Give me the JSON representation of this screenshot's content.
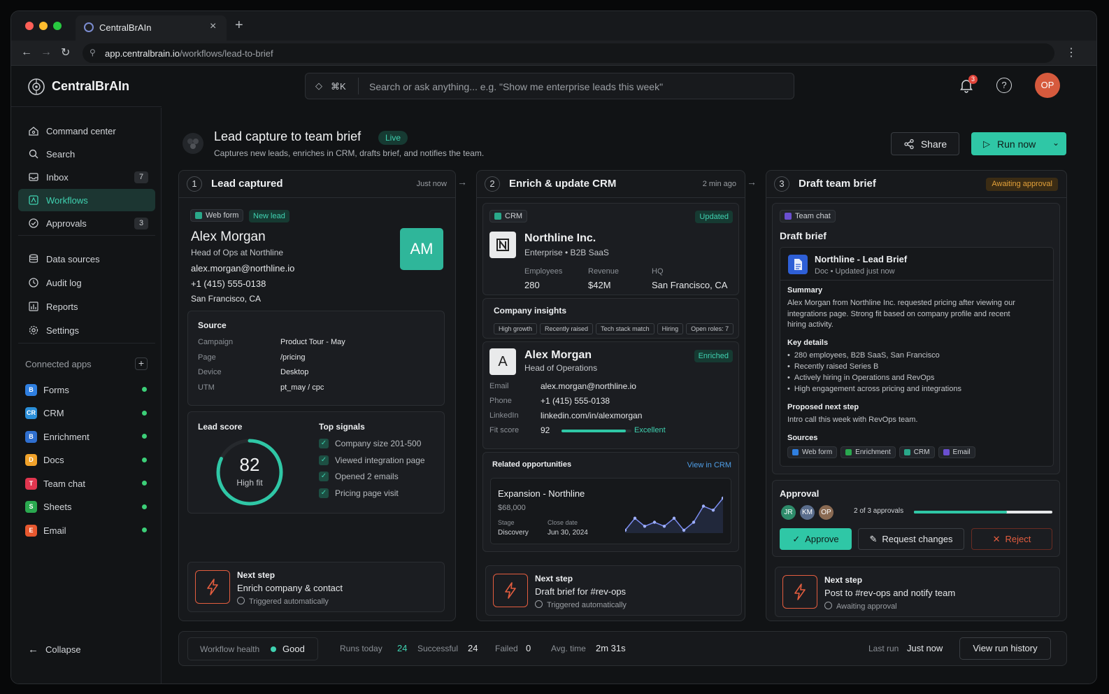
{
  "browser": {
    "tab_title": "CentralBrAIn",
    "url_host": "app.centralbrain.io",
    "url_path": "/workflows/lead-to-brief"
  },
  "brand": {
    "name": "CentralBrAIn"
  },
  "search": {
    "shortcut": "⌘K",
    "placeholder": "Search or ask anything... e.g. \"Show me enterprise leads this week\""
  },
  "header": {
    "notification_count": "3",
    "avatar": "OP"
  },
  "sidebar": {
    "items": [
      {
        "label": "Command center",
        "icon": "home-icon"
      },
      {
        "label": "Search",
        "icon": "search-icon"
      },
      {
        "label": "Inbox",
        "icon": "inbox-icon",
        "count": "7"
      },
      {
        "label": "Workflows",
        "icon": "workflow-icon"
      },
      {
        "label": "Approvals",
        "icon": "check-circle-icon",
        "count": "3"
      },
      {
        "label": "Data sources",
        "icon": "database-icon"
      },
      {
        "label": "Audit log",
        "icon": "audit-icon"
      },
      {
        "label": "Reports",
        "icon": "chart-icon"
      },
      {
        "label": "Settings",
        "icon": "gear-icon"
      }
    ],
    "connected_apps_label": "Connected apps",
    "apps": [
      {
        "label": "Forms",
        "color": "#2f7fe0",
        "glyph": "B"
      },
      {
        "label": "CRM",
        "color": "#2a8ed8",
        "glyph": "CR"
      },
      {
        "label": "Enrichment",
        "color": "#2f6fcf",
        "glyph": "B"
      },
      {
        "label": "Docs",
        "color": "#f0a22a",
        "glyph": "D"
      },
      {
        "label": "Team chat",
        "color": "#e0364f",
        "glyph": "T"
      },
      {
        "label": "Sheets",
        "color": "#2aa84f",
        "glyph": "S"
      },
      {
        "label": "Email",
        "color": "#e7582f",
        "glyph": "E"
      }
    ],
    "collapse": "Collapse"
  },
  "workflow": {
    "title": "Lead capture to team brief",
    "status": "Live",
    "description": "Captures new leads, enriches in CRM, drafts brief, and notifies the team.",
    "share": "Share",
    "run": "Run now"
  },
  "step1": {
    "num": "1",
    "title": "Lead captured",
    "time": "Just now",
    "source_chip": "Web form",
    "tag": "New lead",
    "name": "Alex Morgan",
    "role": "Head of Ops at Northline",
    "email": "alex.morgan@northline.io",
    "phone": "+1 (415) 555-0138",
    "location": "San Francisco, CA",
    "initials": "AM",
    "source_title": "Source",
    "source_rows": [
      {
        "k": "Campaign",
        "v": "Product Tour - May"
      },
      {
        "k": "Page",
        "v": "/pricing"
      },
      {
        "k": "Device",
        "v": "Desktop"
      },
      {
        "k": "UTM",
        "v": "pt_may / cpc"
      }
    ],
    "score_label": "Lead score",
    "score": "82",
    "score_value": 82,
    "score_text": "High fit",
    "signals_title": "Top signals",
    "signals": [
      "Company size 201-500",
      "Viewed integration page",
      "Opened 2 emails",
      "Pricing page visit"
    ],
    "next_label": "Next step",
    "next_action": "Enrich company & contact",
    "next_status": "Triggered automatically"
  },
  "step2": {
    "num": "2",
    "title": "Enrich & update CRM",
    "time": "2 min ago",
    "source_chip": "CRM",
    "tag": "Updated",
    "company": "Northline Inc.",
    "company_meta": "Enterprise • B2B SaaS",
    "stats": [
      {
        "k": "Employees",
        "v": "280"
      },
      {
        "k": "Revenue",
        "v": "$42M"
      },
      {
        "k": "HQ",
        "v": "San Francisco, CA"
      }
    ],
    "insights_title": "Company insights",
    "insights": [
      "High growth",
      "Recently raised",
      "Tech stack match",
      "Hiring",
      "Open roles: 7"
    ],
    "contact_name": "Alex Morgan",
    "contact_role": "Head of Operations",
    "contact_tag": "Enriched",
    "contact_rows": [
      {
        "k": "Email",
        "v": "alex.morgan@northline.io"
      },
      {
        "k": "Phone",
        "v": "+1 (415) 555-0138"
      },
      {
        "k": "LinkedIn",
        "v": "linkedin.com/in/alexmorgan"
      }
    ],
    "fit_label": "Fit score",
    "fit_score": "92",
    "fit_value": 92,
    "fit_text": "Excellent",
    "opps_title": "Related opportunities",
    "opps_link": "View in CRM",
    "opp_name": "Expansion - Northline",
    "opp_amount": "$68,000",
    "opp_stage_label": "Stage",
    "opp_stage": "Discovery",
    "opp_close_label": "Close date",
    "opp_close": "Jun 30, 2024",
    "sparkline": [
      2,
      5,
      3,
      4,
      3,
      5,
      2,
      4,
      8,
      7,
      10
    ],
    "next_label": "Next step",
    "next_action": "Draft brief for #rev-ops",
    "next_status": "Triggered automatically"
  },
  "step3": {
    "num": "3",
    "title": "Draft team brief",
    "status": "Awaiting approval",
    "source_chip": "Team chat",
    "heading": "Draft brief",
    "doc_title": "Northline - Lead Brief",
    "doc_meta": "Doc • Updated just now",
    "summary_label": "Summary",
    "summary": [
      "Alex Morgan from Northline Inc. requested pricing after viewing our",
      "integrations page. Strong fit based on company profile and recent",
      "hiring activity."
    ],
    "details_label": "Key details",
    "details": [
      "280 employees, B2B SaaS, San Francisco",
      "Recently raised Series B",
      "Actively hiring in Operations and RevOps",
      "High engagement across pricing and integrations"
    ],
    "next_step_label": "Proposed next step",
    "next_step": "Intro call this week with RevOps team.",
    "sources_label": "Sources",
    "sources": [
      "Web form",
      "Enrichment",
      "CRM",
      "Email"
    ],
    "approval_label": "Approval",
    "approvers": [
      "JR",
      "KM",
      "OP"
    ],
    "approval_count": "2 of 3 approvals",
    "approval_progress": 0.67,
    "approve": "Approve",
    "request_changes": "Request changes",
    "reject": "Reject",
    "next_label": "Next step",
    "next_action": "Post to #rev-ops and notify team",
    "next_status": "Awaiting approval"
  },
  "footer": {
    "health_label": "Workflow health",
    "health": "Good",
    "runs_label": "Runs today",
    "runs": "24",
    "success_label": "Successful",
    "success": "24",
    "failed_label": "Failed",
    "failed": "0",
    "avg_label": "Avg. time",
    "avg": "2m 31s",
    "last_label": "Last run",
    "last": "Just now",
    "history": "View run history"
  },
  "colors": {
    "accent": "#3fd1b0",
    "warning": "#e3a13a",
    "danger": "#e35d3f"
  }
}
